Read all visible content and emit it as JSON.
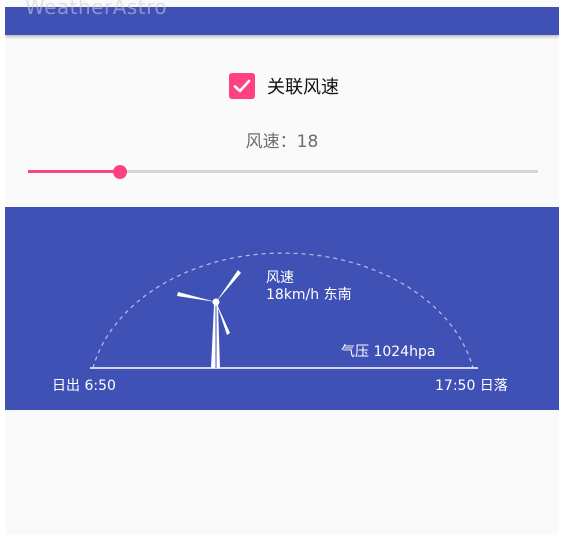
{
  "app": {
    "title": "WeatherAstro"
  },
  "settings": {
    "link_wind_label": "关联风速",
    "link_wind_checked": true,
    "speed_text": "风速：18",
    "speed_value": 18,
    "speed_max": 100
  },
  "weather_panel": {
    "wind_label": "风速",
    "wind_value": "18km/h 东南",
    "pressure": "气压 1024hpa",
    "sunrise": "日出 6:50",
    "sunset": "17:50 日落"
  },
  "colors": {
    "primary": "#3f51b5",
    "accent": "#ff4081",
    "background": "#fafafa"
  },
  "icons": {
    "checkbox": "check-icon",
    "turbine": "wind-turbine-icon"
  }
}
